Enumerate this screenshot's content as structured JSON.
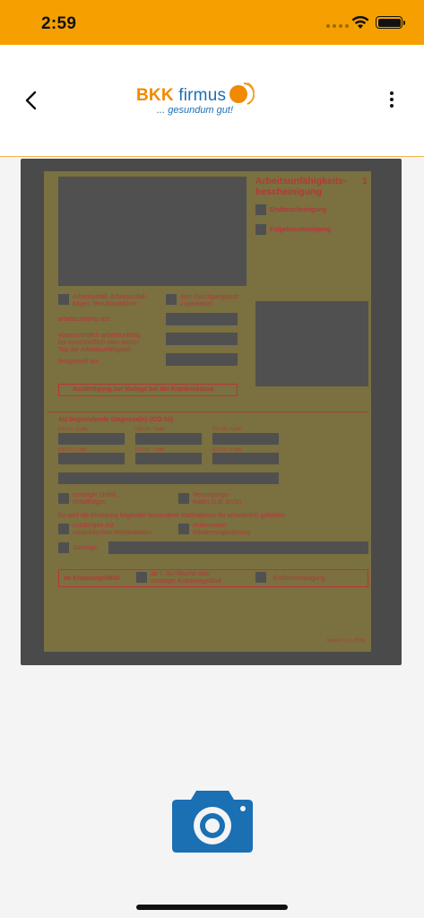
{
  "status_bar": {
    "time": "2:59"
  },
  "header": {
    "logo_brand": "BKK",
    "logo_name": "firmus",
    "logo_tagline": "... gesundum gut!"
  },
  "colors": {
    "status_bar_bg": "#f5a000",
    "brand_orange": "#f08a00",
    "brand_blue": "#1b6fb3",
    "form_red": "#b8353a"
  },
  "icons": {
    "back": "chevron-left-icon",
    "more": "vertical-dots-icon",
    "camera": "camera-icon",
    "wifi": "wifi-icon",
    "battery": "battery-icon"
  },
  "document": {
    "title_line1": "Arbeitsunfähigkeits-",
    "title_line2": "bescheinigung",
    "form_number": "1",
    "erstbescheinigung": "Erstbescheinigung",
    "folgebescheinigung": "Folgebescheinigung",
    "arbeitsunfall": "Arbeitsunfall, Arbeitsunfall-",
    "arbeitsunfall_2": "folgen, Berufskrankheit",
    "durchgangsarzt": "dem Durchgangsarzt",
    "durchgangsarzt_2": "zugewiesen",
    "arbeitsunfaehig_seit": "arbeitsunfähig seit",
    "voraussichtlich_1": "voraussichtlich arbeitsunfähig",
    "voraussichtlich_2": "bis einschließlich oder letzter",
    "voraussichtlich_3": "Tag der Arbeitsunfähigkeit",
    "festgestellt_am": "festgestellt am",
    "ausfertigung": "Ausfertigung zur Vorlage bei der Krankenkasse",
    "diagnose": "AU-begründende Diagnose(n) (ICD-10)",
    "icd_code": "ICD-10 - Code",
    "sonstiger_unfall": "sonstiger Unfall,",
    "sonstiger_unfall_2": "Unfallfolgen",
    "versorgungsleiden": "Versorgungs-",
    "versorgungsleiden_2": "leiden (z.B. BVG)",
    "massnahmen": "Es wird die Einleitung folgender besonderer Maßnahmen für erforderlich gehalten",
    "leistungen_1": "Leistungen zur",
    "leistungen_2": "medizinischen Rehabilitation",
    "stufenweise_1": "stufenweise",
    "stufenweise_2": "Wiedereingliederung",
    "sonstige": "Sonstige",
    "krankengeldfall": "Im Krankengeldfall",
    "ab_au_woche_1": "ab 7. AU-Woche oder",
    "ab_au_woche_2": "sonstiger Krankengeldfall",
    "endbescheinigung": "Endbescheinigung",
    "muster": "Muster 1a (1.2018)"
  }
}
